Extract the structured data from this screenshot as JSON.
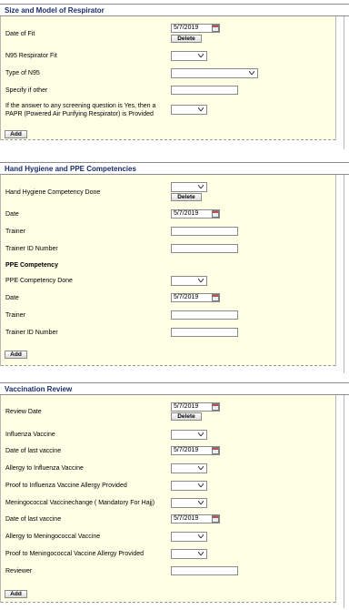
{
  "sections": {
    "respirator": {
      "title": "Size and Model of Respirator",
      "date_of_fit_label": "Date of Fit",
      "date_of_fit_value": "5/7/2019",
      "delete_label": "Delete",
      "n95_fit_label": "N95 Respirator Fit",
      "type_n95_label": "Type of N95",
      "specify_other_label": "Specify if other",
      "papr_label_1": "If the answer to any screening question is Yes, then a",
      "papr_label_2": "PAPR (Powered Air Purifying Respirator) is Provided",
      "add_label": "Add"
    },
    "hygiene": {
      "title": "Hand Hygiene and PPE Competencies",
      "hh_done_label": "Hand Hygiene Competency Done",
      "delete_label": "Delete",
      "date_label": "Date",
      "date_value": "5/7/2019",
      "trainer_label": "Trainer",
      "trainer_id_label": "Trainer ID Number",
      "ppe_heading": "PPE Competency",
      "ppe_done_label": "PPE Competency Done",
      "date2_label": "Date",
      "date2_value": "5/7/2019",
      "trainer2_label": "Trainer",
      "trainer_id2_label": "Trainer ID Number",
      "add_label": "Add"
    },
    "vaccination": {
      "title": "Vaccination Review",
      "review_date_label": "Review Date",
      "review_date_value": "5/7/2019",
      "delete_label": "Delete",
      "influenza_label": "Influenza Vaccine",
      "last_vaccine_label": "Date of last vaccine",
      "last_vaccine_value": "5/7/2019",
      "allergy_flu_label": "Allergy to Influenza Vaccine",
      "proof_flu_label": "Proof to Influenza Vaccine Allergy Provided",
      "mening_label": "Meningococcal Vaccinechange ( Mandatory For Hajj)",
      "last_vaccine2_label": "Date of last vaccine",
      "last_vaccine2_value": "5/7/2019",
      "allergy_mening_label": "Allergy to Meningococcal Vaccine",
      "proof_mening_label": "Proof to Meningococcal Vaccine Allergy Provided",
      "reviewer_label": "Reviewer",
      "add_label": "Add"
    }
  },
  "colors": {
    "header_text": "#1a2d6b",
    "form_background": "#ffffe6"
  },
  "icons": [
    "calendar-icon",
    "chevron-down-icon"
  ]
}
